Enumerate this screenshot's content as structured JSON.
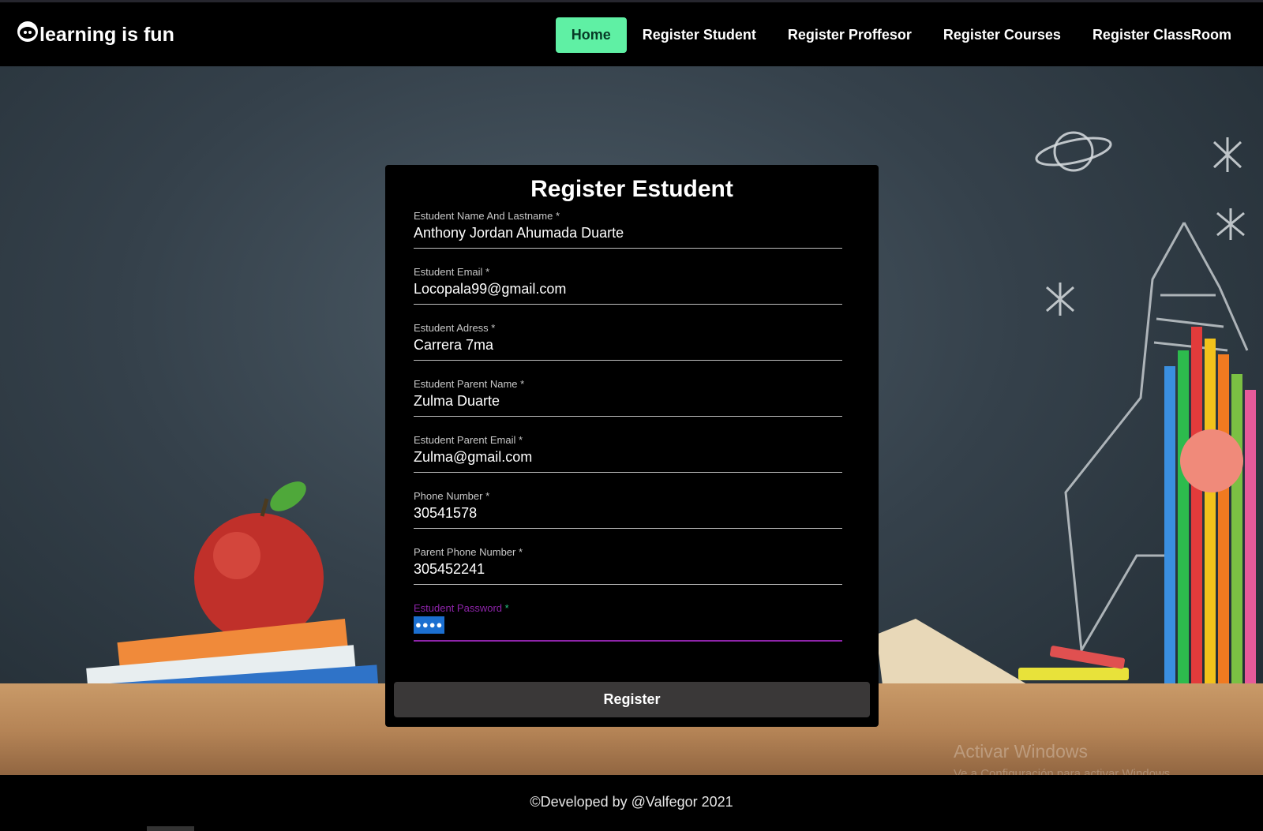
{
  "brand": {
    "name": "learning is fun",
    "icon": "smiley-face-icon"
  },
  "nav": {
    "items": [
      {
        "label": "Home",
        "active": true
      },
      {
        "label": "Register Student",
        "active": false
      },
      {
        "label": "Register Proffesor",
        "active": false
      },
      {
        "label": "Register Courses",
        "active": false
      },
      {
        "label": "Register ClassRoom",
        "active": false
      }
    ],
    "active_color": "#5ff0a4"
  },
  "form": {
    "title": "Register Estudent",
    "fields": [
      {
        "label": "Estudent Name And Lastname",
        "value": "Anthony Jordan Ahumada Duarte"
      },
      {
        "label": "Estudent Email",
        "value": "Locopala99@gmail.com"
      },
      {
        "label": "Estudent Adress",
        "value": "Carrera 7ma"
      },
      {
        "label": "Estudent Parent Name",
        "value": "Zulma Duarte"
      },
      {
        "label": "Estudent Parent Email",
        "value": "Zulma@gmail.com"
      },
      {
        "label": "Phone Number",
        "value": "30541578"
      },
      {
        "label": "Parent Phone Number",
        "value": "305452241"
      },
      {
        "label": "Estudent Password",
        "value": "●●●●"
      }
    ],
    "required_marker": "*",
    "focus_color": "#8e24aa",
    "submit_label": "Register"
  },
  "watermark": {
    "title": "Activar Windows",
    "subtitle": "Ve a Configuración para activar Windows."
  },
  "footer": {
    "text": "©Developed by @Valfegor 2021"
  }
}
